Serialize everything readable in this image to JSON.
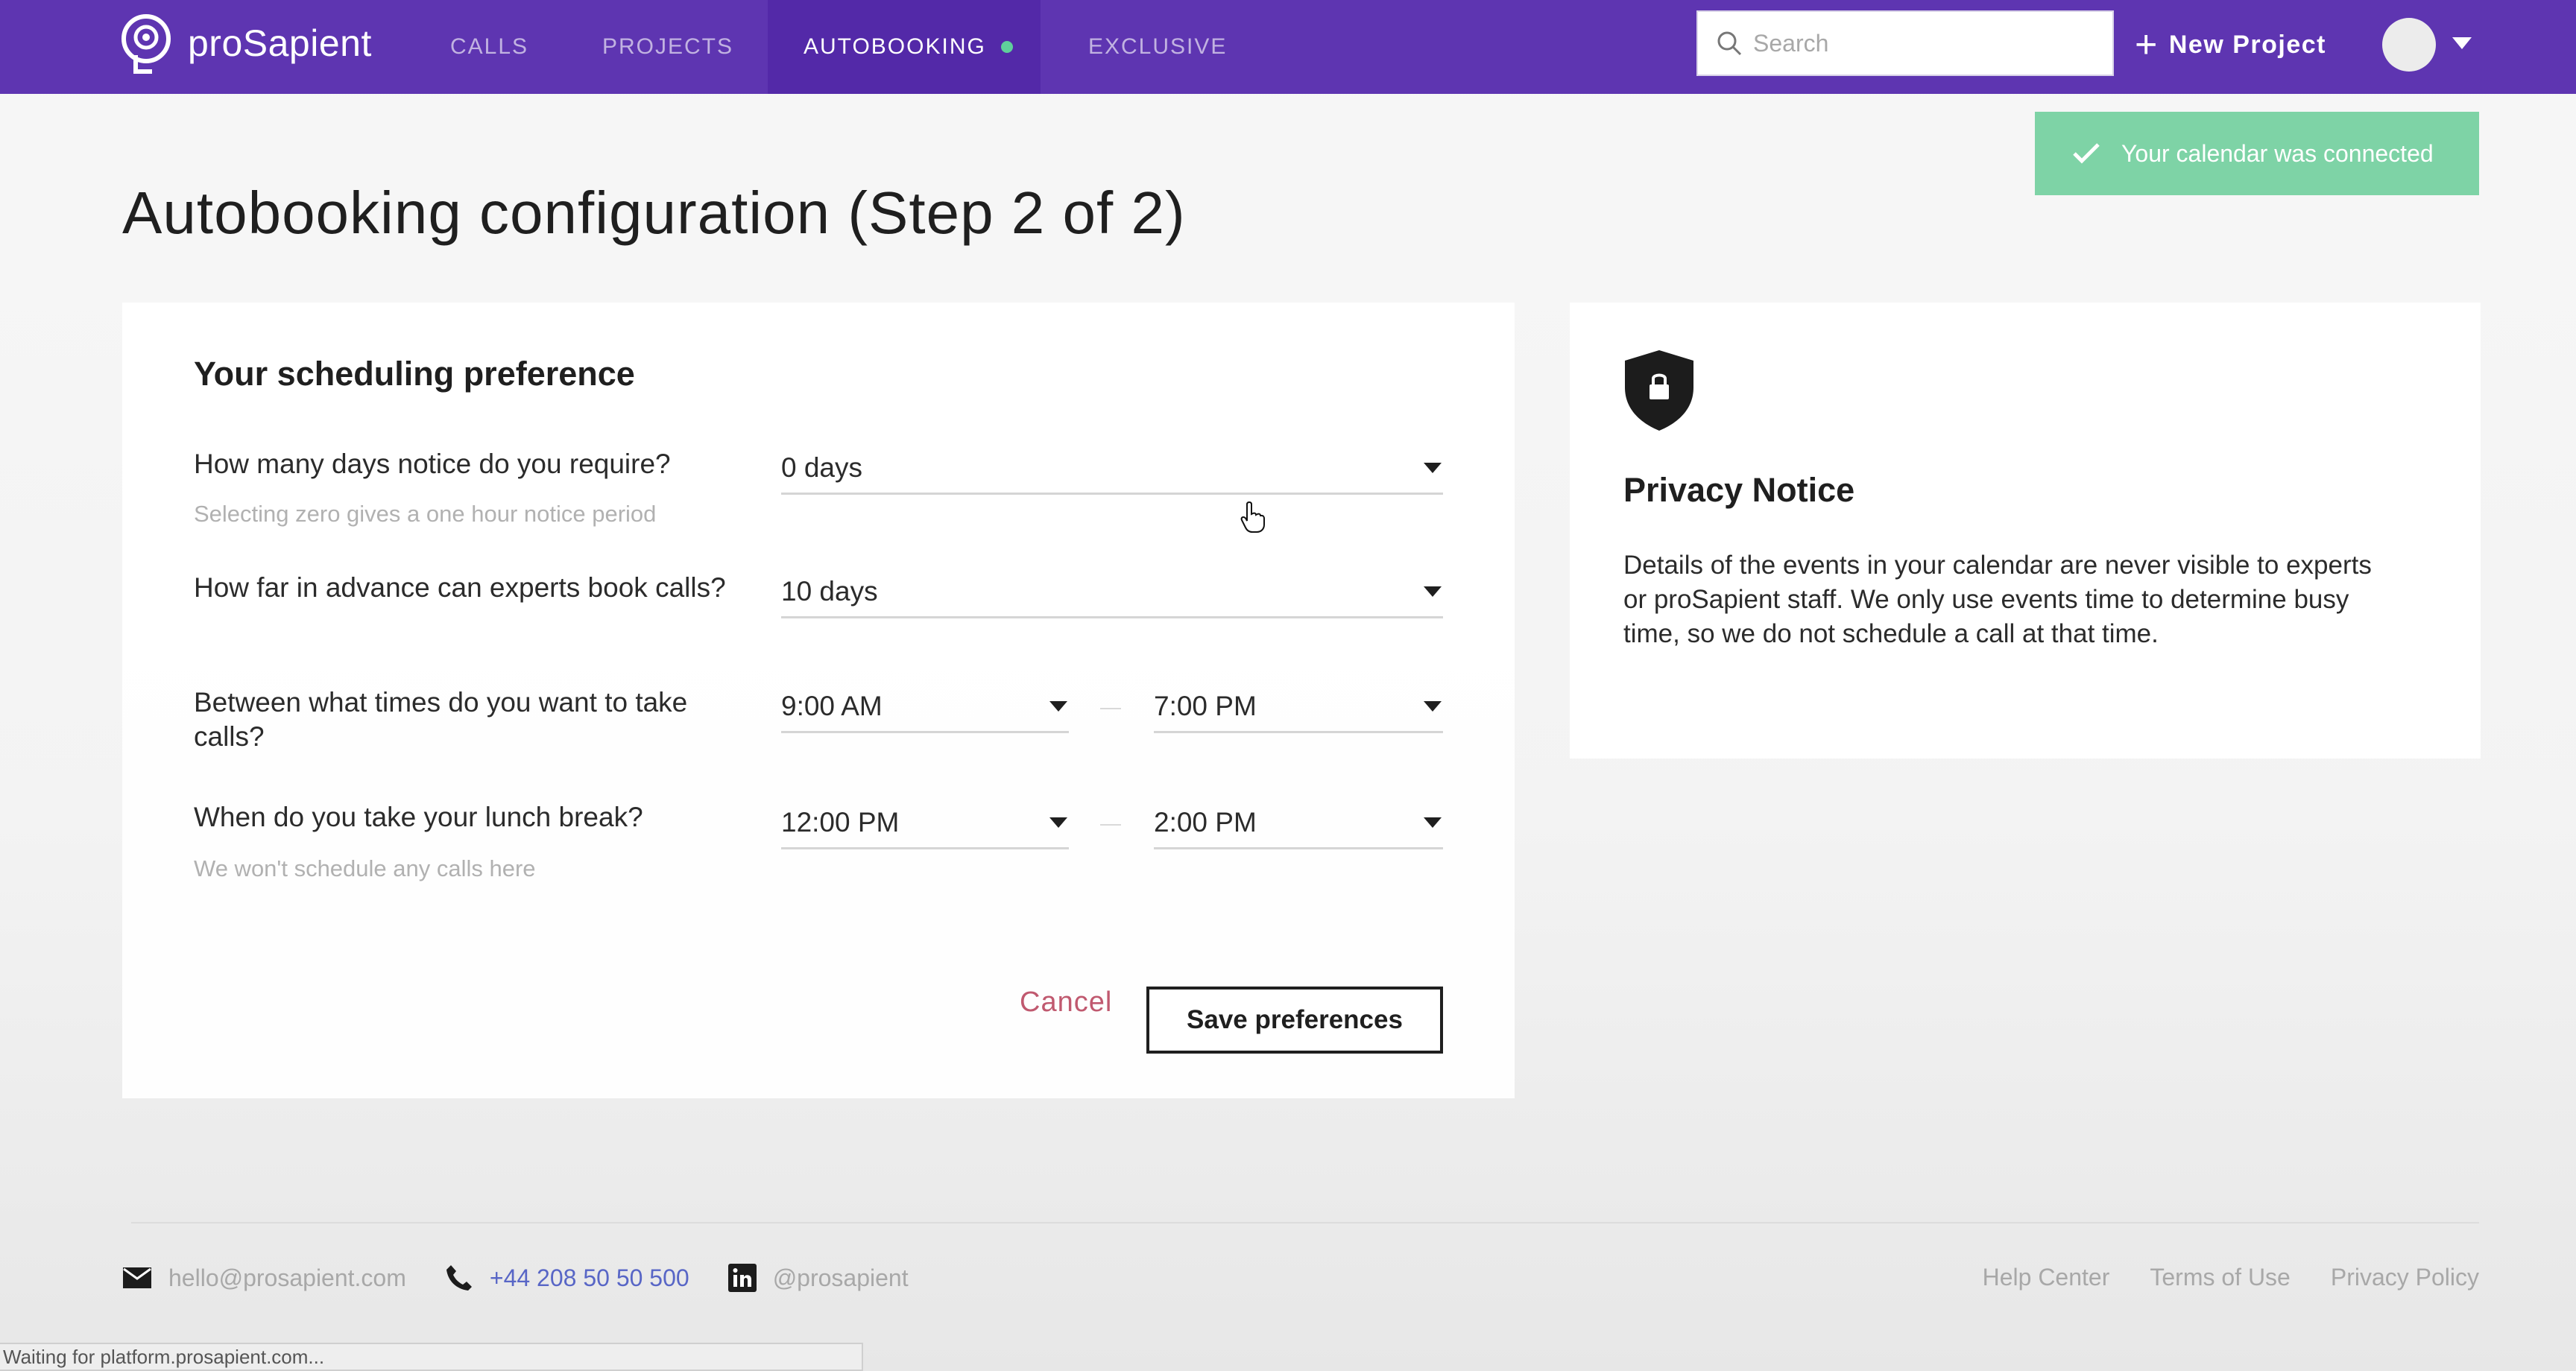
{
  "nav": {
    "brand": "proSapient",
    "items": [
      {
        "label": "CALLS",
        "active": false
      },
      {
        "label": "PROJECTS",
        "active": false
      },
      {
        "label": "AUTOBOOKING",
        "active": true
      },
      {
        "label": "EXCLUSIVE",
        "active": false
      }
    ],
    "search_placeholder": "Search",
    "new_project_label": "New Project",
    "brand_color": "#5e35b1",
    "active_dot_color": "#5fcf9b"
  },
  "toast": {
    "message": "Your calendar was connected",
    "color": "#7ed3a6"
  },
  "page": {
    "title": "Autobooking configuration (Step 2 of 2)"
  },
  "preferences": {
    "heading": "Your scheduling preference",
    "notice": {
      "question": "How many days notice do you require?",
      "hint": "Selecting zero gives a one hour notice period",
      "value": "0 days"
    },
    "advance": {
      "question": "How far in advance can experts book calls?",
      "value": "10 days"
    },
    "call_times": {
      "question": "Between what times do you want to take calls?",
      "start": "9:00 AM",
      "end": "7:00 PM"
    },
    "lunch": {
      "question": "When do you take your lunch break?",
      "hint": "We won't schedule any calls here",
      "start": "12:00 PM",
      "end": "2:00 PM"
    },
    "cancel_label": "Cancel",
    "save_label": "Save preferences"
  },
  "privacy": {
    "title": "Privacy Notice",
    "text": "Details of the events in your calendar are never visible to experts or proSapient staff. We only use events time to determine busy time, so we do not schedule a call at that time."
  },
  "footer": {
    "email": "hello@prosapient.com",
    "phone": "+44 208 50 50 500",
    "linkedin": "@prosapient",
    "links": [
      "Help Center",
      "Terms of Use",
      "Privacy Policy"
    ]
  },
  "status_bar": "Waiting for platform.prosapient.com..."
}
